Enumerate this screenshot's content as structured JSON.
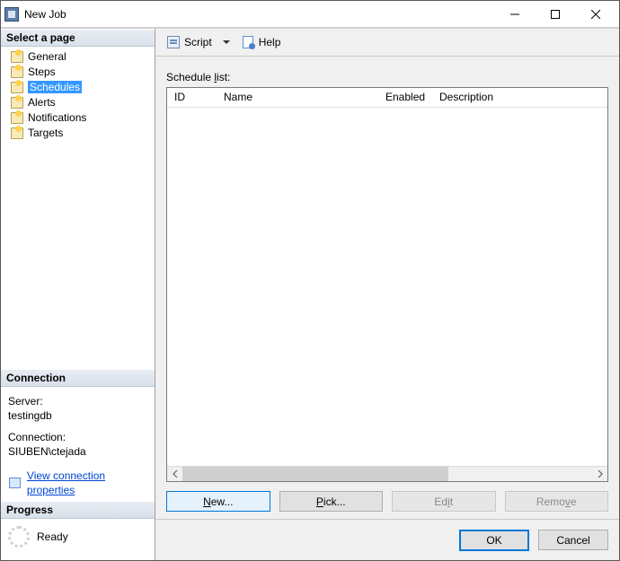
{
  "window": {
    "title": "New Job"
  },
  "titlebar_buttons": {
    "minimize": "–",
    "maximize": "□",
    "close": "×"
  },
  "sidebar": {
    "select_head": "Select a page",
    "items": [
      {
        "label": "General"
      },
      {
        "label": "Steps"
      },
      {
        "label": "Schedules"
      },
      {
        "label": "Alerts"
      },
      {
        "label": "Notifications"
      },
      {
        "label": "Targets"
      }
    ],
    "selected_index": 2,
    "connection_head": "Connection",
    "connection": {
      "server_label": "Server:",
      "server_value": "testingdb",
      "conn_label": "Connection:",
      "conn_value": "SIUBEN\\ctejada",
      "view_props": "View connection properties"
    },
    "progress_head": "Progress",
    "progress_status": "Ready"
  },
  "toolbar": {
    "script": "Script",
    "help": "Help"
  },
  "content": {
    "list_label_pre": "Schedule ",
    "list_label_ul": "l",
    "list_label_post": "ist:",
    "columns": {
      "id": "ID",
      "name": "Name",
      "enabled": "Enabled",
      "desc": "Description"
    }
  },
  "buttons": {
    "new_ul": "N",
    "new_post": "ew...",
    "pick_ul": "P",
    "pick_post": "ick...",
    "edit_pre": "Ed",
    "edit_ul": "i",
    "edit_post": "t",
    "remove_pre": "Remo",
    "remove_ul": "v",
    "remove_post": "e"
  },
  "footer": {
    "ok": "OK",
    "cancel": "Cancel"
  }
}
